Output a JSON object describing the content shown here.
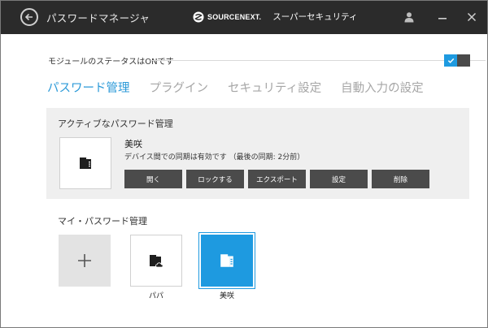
{
  "titlebar": {
    "title": "パスワードマネージャ",
    "brand_name": "SOURCENEXT.",
    "product": "スーパーセキュリティ",
    "icons": [
      "back-arrow-icon",
      "user-icon",
      "minimize-icon",
      "close-icon"
    ]
  },
  "module": {
    "label": "モジュールのステータスはONです",
    "enabled": true
  },
  "tabs": [
    {
      "label": "パスワード管理",
      "active": true
    },
    {
      "label": "プラグイン",
      "active": false
    },
    {
      "label": "セキュリティ設定",
      "active": false
    },
    {
      "label": "自動入力の設定",
      "active": false
    }
  ],
  "active_vault": {
    "heading": "アクティブなパスワード管理",
    "name": "美咲",
    "status": "デバイス間での同期は有効です （最後の同期: 2分前）",
    "buttons": [
      "開く",
      "ロックする",
      "エクスポート",
      "設定",
      "削除"
    ]
  },
  "my_vaults": {
    "heading": "マイ・パスワード管理",
    "items": [
      {
        "name": "パパ",
        "selected": false,
        "icon": "vault-cloud-icon"
      },
      {
        "name": "美咲",
        "selected": true,
        "icon": "vault-icon"
      }
    ]
  },
  "colors": {
    "accent": "#1e9ae0",
    "titlebar": "#2b2b2b",
    "button": "#4b4b4b"
  }
}
